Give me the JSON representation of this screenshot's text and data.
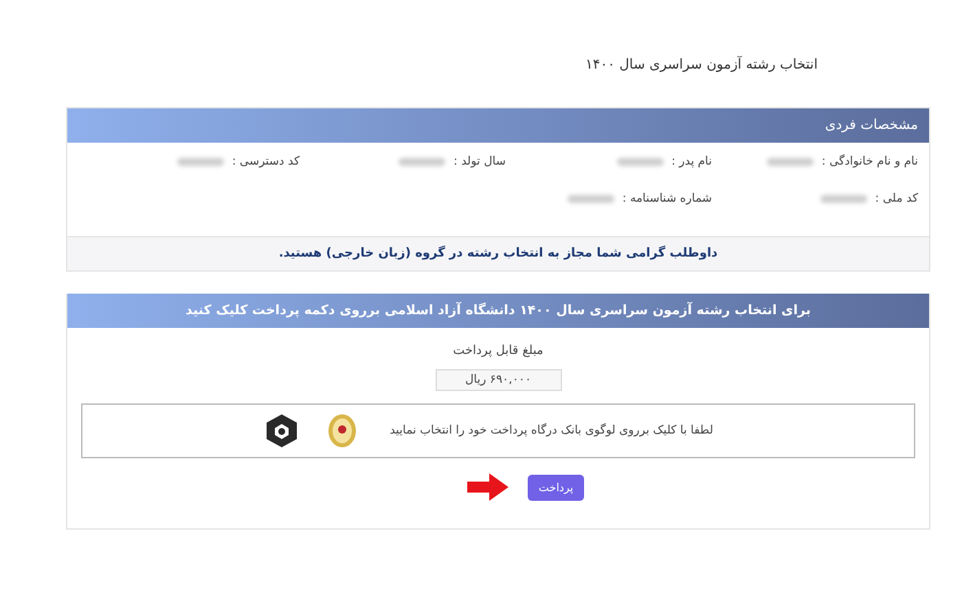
{
  "page_title": "انتخاب رشته آزمون سراسری سال ۱۴۰۰",
  "personal_panel": {
    "title": "مشخصات فردی",
    "rows": [
      [
        {
          "label": "نام و نام خانوادگی :",
          "blurred": true
        },
        {
          "label": "نام پدر :",
          "blurred": true
        },
        {
          "label": "سال تولد :",
          "blurred": true
        },
        {
          "label": "کد دسترسی :",
          "blurred": true
        }
      ],
      [
        {
          "label": "کد ملی :",
          "blurred": true
        },
        {
          "label": "شماره شناسنامه :",
          "blurred": true
        }
      ]
    ]
  },
  "notice": "داوطلب گرامی شما مجاز به انتخاب رشته در گروه (زبان خارجی) هستید.",
  "payment_panel": {
    "title": "برای انتخاب رشته آزمون سراسری سال ۱۴۰۰ دانشگاه آزاد اسلامی برروی دکمه پرداخت کلیک کنید",
    "amount_label": "مبلغ قابل پرداخت",
    "amount": "۶۹۰,۰۰۰  ریال",
    "bank_instruction": "لطفا با کلیک برروی لوگوی بانک درگاه پرداخت خود را انتخاب نمایید",
    "banks": [
      {
        "kind": "emblem"
      },
      {
        "kind": "knot"
      }
    ],
    "pay_button": "پرداخت"
  }
}
